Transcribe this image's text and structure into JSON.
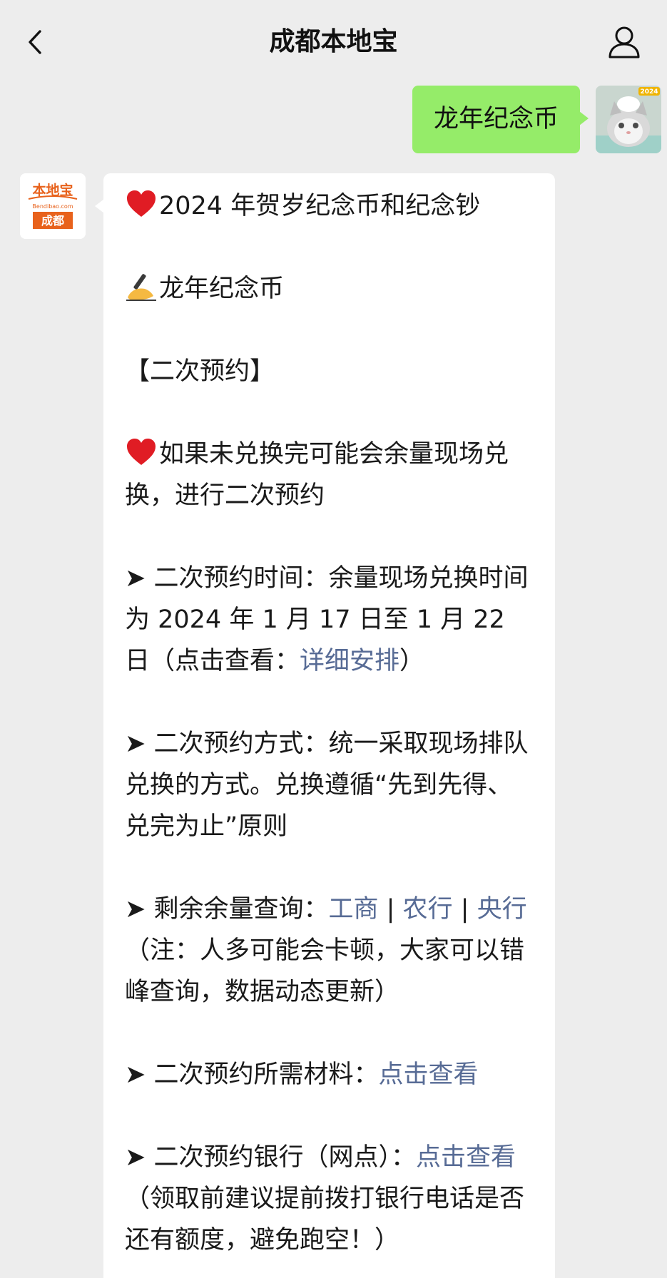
{
  "header": {
    "title": "成都本地宝"
  },
  "outgoing": {
    "text": "龙年纪念币",
    "avatar_badge": "2024"
  },
  "bot": {
    "logo_top": "本地宝",
    "logo_url": "Bendibao.com",
    "logo_city": "成都"
  },
  "message": {
    "line1": "2024 年贺岁纪念币和纪念钞",
    "line2": "龙年纪念币",
    "line3": "【二次预约】",
    "para1": "如果未兑换完可能会余量现场兑换，进行二次预约",
    "bullet": "➤",
    "item1_text": " 二次预约时间：余量现场兑换时间为 2024 年 1 月 17 日至 1 月 22 日（点击查看：",
    "item1_link": "详细安排",
    "item1_tail": "）",
    "item2_text": " 二次预约方式：统一采取现场排队兑换的方式。兑换遵循“先到先得、兑完为止”原则",
    "item3_text": " 剩余余量查询：",
    "item3_link1": "工商",
    "item3_sep1": " | ",
    "item3_link2": "农行",
    "item3_sep2": " | ",
    "item3_link3": "央行",
    "item3_tail": "（注：人多可能会卡顿，大家可以错峰查询，数据动态更新）",
    "item4_text": " 二次预约所需材料：",
    "item4_link": "点击查看",
    "item5_text": " 二次预约银行（网点）：",
    "item5_link": "点击查看",
    "item5_tail": "（领取前建议提前拨打银行电话是否还有额度，避免跑空！）"
  },
  "colors": {
    "background": "#ededed",
    "outgoing_bubble": "#95ec69",
    "link": "#576b95",
    "logo_orange": "#e8621c"
  },
  "icons": [
    "back-chevron-icon",
    "user-profile-icon",
    "heart-icon",
    "writing-hand-icon"
  ]
}
